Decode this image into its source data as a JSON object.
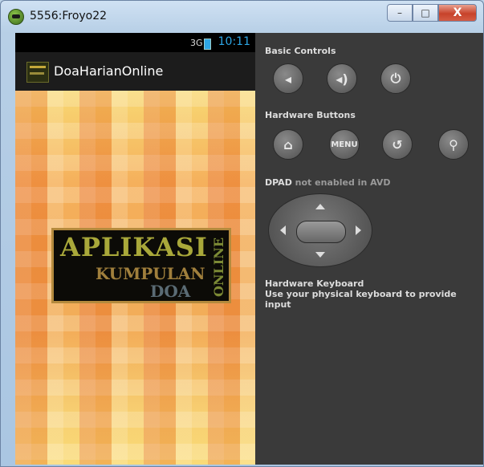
{
  "window": {
    "title": "5556:Froyo22",
    "minimize": "–",
    "maximize": "□",
    "close": "X"
  },
  "phone": {
    "status_time": "10:11",
    "signal": "3G",
    "app_title": "DoaHarianOnline",
    "banner": {
      "line1": "APLIKASI",
      "line2": "KUMPULAN",
      "line3": "DOA",
      "vertical": "ONLINE"
    }
  },
  "controls": {
    "basic_title": "Basic Controls",
    "hardware_title": "Hardware Buttons",
    "menu_label": "MENU",
    "dpad_title": "DPAD",
    "dpad_note": "not enabled in AVD",
    "keyboard_title": "Hardware Keyboard",
    "keyboard_note": "Use your physical keyboard to provide input"
  },
  "icons": [
    "volume-down-icon",
    "volume-up-icon",
    "power-icon",
    "home-icon",
    "back-icon",
    "search-icon"
  ]
}
